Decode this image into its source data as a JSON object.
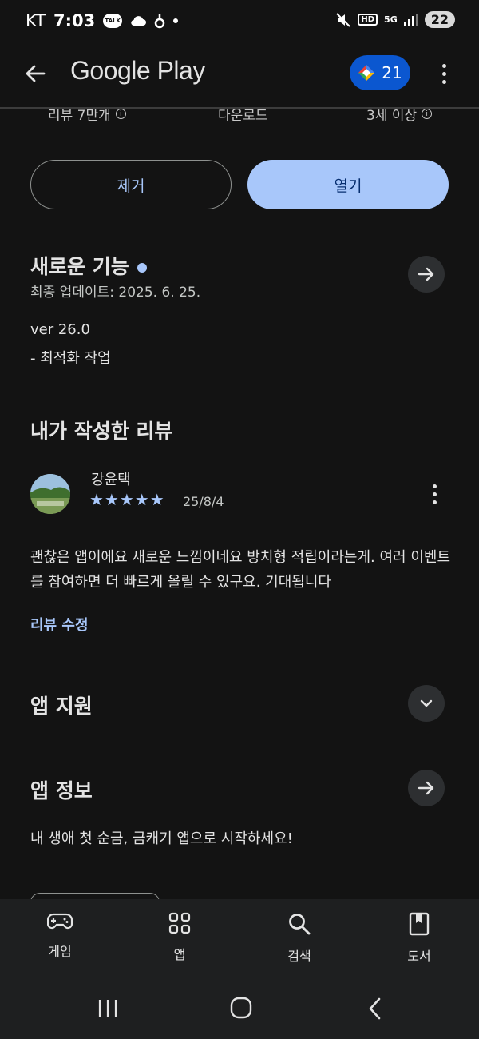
{
  "status_bar": {
    "carrier": "KT",
    "time": "7:03",
    "talk_badge": "TALK",
    "hd_label": "HD",
    "network": "5G",
    "battery": "22"
  },
  "app_bar": {
    "title": "Google Play",
    "points_count": "21"
  },
  "stats": {
    "reviews": "리뷰 7만개",
    "downloads": "다운로드",
    "age_rating": "3세 이상"
  },
  "actions": {
    "remove_label": "제거",
    "open_label": "열기"
  },
  "whats_new": {
    "title": "새로운 기능",
    "updated": "최종 업데이트: 2025. 6. 25.",
    "version": "ver 26.0",
    "notes": "- 최적화 작업"
  },
  "my_review": {
    "title": "내가 작성한 리뷰",
    "reviewer": "강윤택",
    "rating": 5,
    "stars": "★★★★★",
    "date": "25/8/4",
    "text": "괜찮은 앱이에요 새로운 느낌이네요 방치형 적립이라는게. 여러 이벤트를 참여하면 더 빠르게 올릴 수 있구요. 기대됩니다",
    "edit_label": "리뷰 수정"
  },
  "app_support": {
    "title": "앱 지원"
  },
  "app_info": {
    "title": "앱 정보",
    "description": "내 생애 첫 순금, 금캐기 앱으로 시작하세요!"
  },
  "bottom_nav": {
    "items": [
      {
        "label": "게임",
        "icon": "gamepad-icon"
      },
      {
        "label": "앱",
        "icon": "apps-grid-icon"
      },
      {
        "label": "검색",
        "icon": "search-icon"
      },
      {
        "label": "도서",
        "icon": "book-icon"
      }
    ]
  },
  "colors": {
    "background": "#131313",
    "accent": "#a8c7fa",
    "points_chip": "#0b57d0",
    "nav_background": "#1e1f20"
  }
}
